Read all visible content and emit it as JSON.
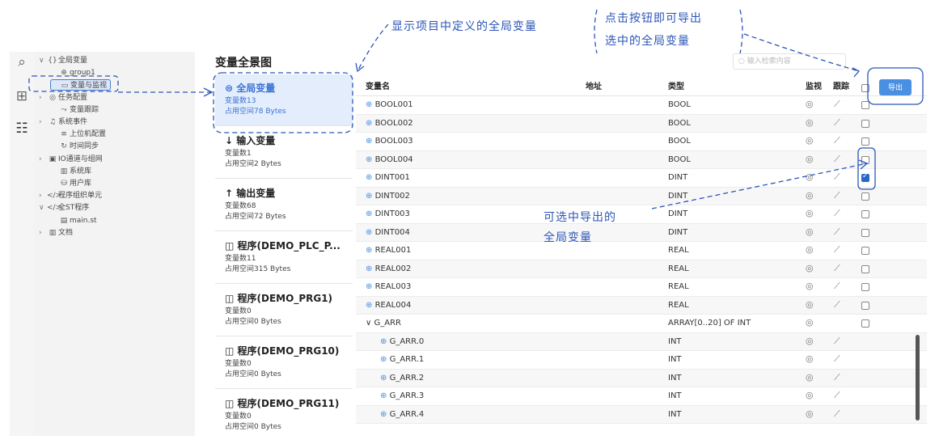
{
  "tree": {
    "items": [
      {
        "arrow": "∨",
        "icon": "{}",
        "label": "全局变量"
      },
      {
        "arrow": "",
        "icon": "⊕",
        "label": "group1"
      },
      {
        "arrow": "",
        "icon": "▭",
        "label": "变量与监视"
      },
      {
        "arrow": "›",
        "icon": "◎",
        "label": "任务配置"
      },
      {
        "arrow": "",
        "icon": "⤳",
        "label": "变量跟踪"
      },
      {
        "arrow": "›",
        "icon": "♫",
        "label": "系统事件"
      },
      {
        "arrow": "",
        "icon": "≡",
        "label": "上位机配置"
      },
      {
        "arrow": "",
        "icon": "↻",
        "label": "时间同步"
      },
      {
        "arrow": "›",
        "icon": "▣",
        "label": "IO通道与组网"
      },
      {
        "arrow": "",
        "icon": "▥",
        "label": "系统库"
      },
      {
        "arrow": "",
        "icon": "⛁",
        "label": "用户库"
      },
      {
        "arrow": "›",
        "icon": "</>",
        "label": "程序组织单元"
      },
      {
        "arrow": "∨",
        "icon": "</>",
        "label": "全ST程序"
      },
      {
        "arrow": "",
        "icon": "▤",
        "label": "main.st"
      },
      {
        "arrow": "›",
        "icon": "▥",
        "label": "文档"
      }
    ]
  },
  "middle": {
    "title": "变量全景图",
    "cards": [
      {
        "icon": "⊜",
        "title": "全局变量",
        "count": "变量数13",
        "space": "占用空间78 Bytes"
      },
      {
        "icon": "↓",
        "title": "输入变量",
        "count": "变量数1",
        "space": "占用空间2 Bytes"
      },
      {
        "icon": "↑",
        "title": "输出变量",
        "count": "变量数68",
        "space": "占用空间72 Bytes"
      },
      {
        "icon": "◫",
        "title": "程序(DEMO_PLC_P...",
        "count": "变量数11",
        "space": "占用空间315 Bytes"
      },
      {
        "icon": "◫",
        "title": "程序(DEMO_PRG1)",
        "count": "变量数0",
        "space": "占用空间0 Bytes"
      },
      {
        "icon": "◫",
        "title": "程序(DEMO_PRG10)",
        "count": "变量数0",
        "space": "占用空间0 Bytes"
      },
      {
        "icon": "◫",
        "title": "程序(DEMO_PRG11)",
        "count": "变量数0",
        "space": "占用空间0 Bytes"
      }
    ]
  },
  "search": {
    "placeholder": "输入检索内容"
  },
  "export": {
    "label": "导出"
  },
  "table": {
    "headers": {
      "name": "变量名",
      "addr": "地址",
      "type": "类型",
      "monitor": "监视",
      "trace": "跟踪"
    },
    "rows": [
      {
        "name": "BOOL001",
        "type": "BOOL",
        "checked": false
      },
      {
        "name": "BOOL002",
        "type": "BOOL",
        "checked": false
      },
      {
        "name": "BOOL003",
        "type": "BOOL",
        "checked": false
      },
      {
        "name": "BOOL004",
        "type": "BOOL",
        "checked": false
      },
      {
        "name": "DINT001",
        "type": "DINT",
        "checked": true
      },
      {
        "name": "DINT002",
        "type": "DINT",
        "checked": false
      },
      {
        "name": "DINT003",
        "type": "DINT",
        "checked": false
      },
      {
        "name": "DINT004",
        "type": "DINT",
        "checked": false
      },
      {
        "name": "REAL001",
        "type": "REAL",
        "checked": false
      },
      {
        "name": "REAL002",
        "type": "REAL",
        "checked": false
      },
      {
        "name": "REAL003",
        "type": "REAL",
        "checked": false
      },
      {
        "name": "REAL004",
        "type": "REAL",
        "checked": false
      },
      {
        "name": "G_ARR",
        "type": "ARRAY[0..20] OF INT",
        "checked": false,
        "group": true
      },
      {
        "name": "G_ARR.0",
        "type": "INT",
        "child": true
      },
      {
        "name": "G_ARR.1",
        "type": "INT",
        "child": true
      },
      {
        "name": "G_ARR.2",
        "type": "INT",
        "child": true
      },
      {
        "name": "G_ARR.3",
        "type": "INT",
        "child": true
      },
      {
        "name": "G_ARR.4",
        "type": "INT",
        "child": true
      }
    ]
  },
  "annotations": {
    "top": "显示项目中定义的全局变量",
    "right_line1": "点击按钮即可导出",
    "right_line2": "选中的全局变量",
    "mid_line1": "可选中导出的",
    "mid_line2": "全局变量"
  },
  "colors": {
    "accent": "#4a90e2",
    "annotation": "#2c55b8",
    "selected_card": "#e4edfc"
  }
}
